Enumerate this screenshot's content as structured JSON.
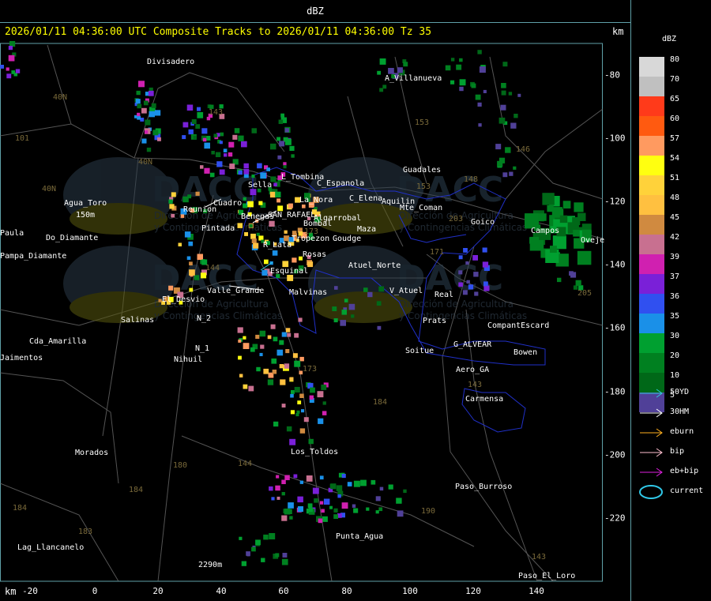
{
  "window": {
    "title": "dBZ"
  },
  "header": {
    "text": "2026/01/11 04:36:00 UTC Composite Tracks to 2026/01/11 04:36:00 Tz 35",
    "unit_top": "km",
    "unit_bottom": "km"
  },
  "axes": {
    "x_ticks": [
      "-20",
      "0",
      "20",
      "40",
      "60",
      "80",
      "100",
      "120",
      "140"
    ],
    "y_ticks": [
      "-80",
      "-100",
      "-120",
      "-140",
      "-160",
      "-180",
      "-200",
      "-220"
    ]
  },
  "legend": {
    "title": "dBZ",
    "levels": [
      {
        "value": "80",
        "color": "#d8d8d8"
      },
      {
        "value": "70",
        "color": "#c0c0c0"
      },
      {
        "value": "65",
        "color": "#ff3a1a"
      },
      {
        "value": "60",
        "color": "#ff5a10"
      },
      {
        "value": "57",
        "color": "#ff9a60"
      },
      {
        "value": "54",
        "color": "#ffff10"
      },
      {
        "value": "51",
        "color": "#ffd23a"
      },
      {
        "value": "48",
        "color": "#ffc040"
      },
      {
        "value": "45",
        "color": "#d08a40"
      },
      {
        "value": "42",
        "color": "#c87090"
      },
      {
        "value": "39",
        "color": "#d020b0"
      },
      {
        "value": "37",
        "color": "#7a20d8"
      },
      {
        "value": "36",
        "color": "#3050f0"
      },
      {
        "value": "35",
        "color": "#1a90e8"
      },
      {
        "value": "30",
        "color": "#00a030"
      },
      {
        "value": "20",
        "color": "#008020"
      },
      {
        "value": "10",
        "color": "#006818"
      },
      {
        "value": "5",
        "color": "#504098"
      }
    ],
    "tracks": [
      {
        "label": "50YD",
        "color": "#30c8d8"
      },
      {
        "label": "30HM",
        "color": "#ffffff"
      },
      {
        "label": "eburn",
        "color": "#ffb020"
      },
      {
        "label": "bip",
        "color": "#ffc0d0"
      },
      {
        "label": "eb+bip",
        "color": "#e020e0"
      },
      {
        "label": "current",
        "color": "#30c8e8"
      }
    ]
  },
  "map_labels": [
    "Divisadero",
    "A_Villanueva",
    "Guadales",
    "L_Tombina",
    "C_Espanola",
    "Sella",
    "Agua_Toro",
    "150m",
    "Do_Diamante",
    "Pampa_Diamante",
    "Reunion",
    "Pintada",
    "Benegas",
    "SAN_RAFAEL",
    "La_Nora",
    "C_Elena",
    "Aquilin",
    "Mte_Coman",
    "Algarrobal",
    "Tropezon",
    "Goudge",
    "Cuadro",
    "R_Lata",
    "Bombal",
    "Rosas",
    "Atuel_Norte",
    "Esquinal",
    "El_Desvio",
    "Valle_Grande",
    "Malvinas",
    "V_Atuel",
    "Real",
    "N_2",
    "N_1",
    "Salinas",
    "Nihuil",
    "Cda_Amarilla",
    "Jaimentos",
    "Prats",
    "CompantEscard",
    "G_ALVEAR",
    "Soitue",
    "Bowen",
    "Aero_GA",
    "Carmensa",
    "Los_Toldos",
    "Morados",
    "Paso_Burroso",
    "Punta_Agua",
    "Lag_Llancanelo",
    "2290m",
    "Paso_El_Loro",
    "Goico",
    "Campos",
    "Oveje",
    "Maza",
    "Paula"
  ],
  "route_numbers": [
    "101",
    "143",
    "40N",
    "40N",
    "153",
    "153",
    "148",
    "173",
    "171",
    "146",
    "203",
    "144",
    "173",
    "144",
    "184",
    "180",
    "184",
    "190",
    "184",
    "183",
    "143",
    "205",
    "40N",
    "143"
  ],
  "watermark": {
    "brand": "DACC",
    "line1": "Dirección de Agricultura",
    "line2": "y Contingencias Climáticas"
  }
}
